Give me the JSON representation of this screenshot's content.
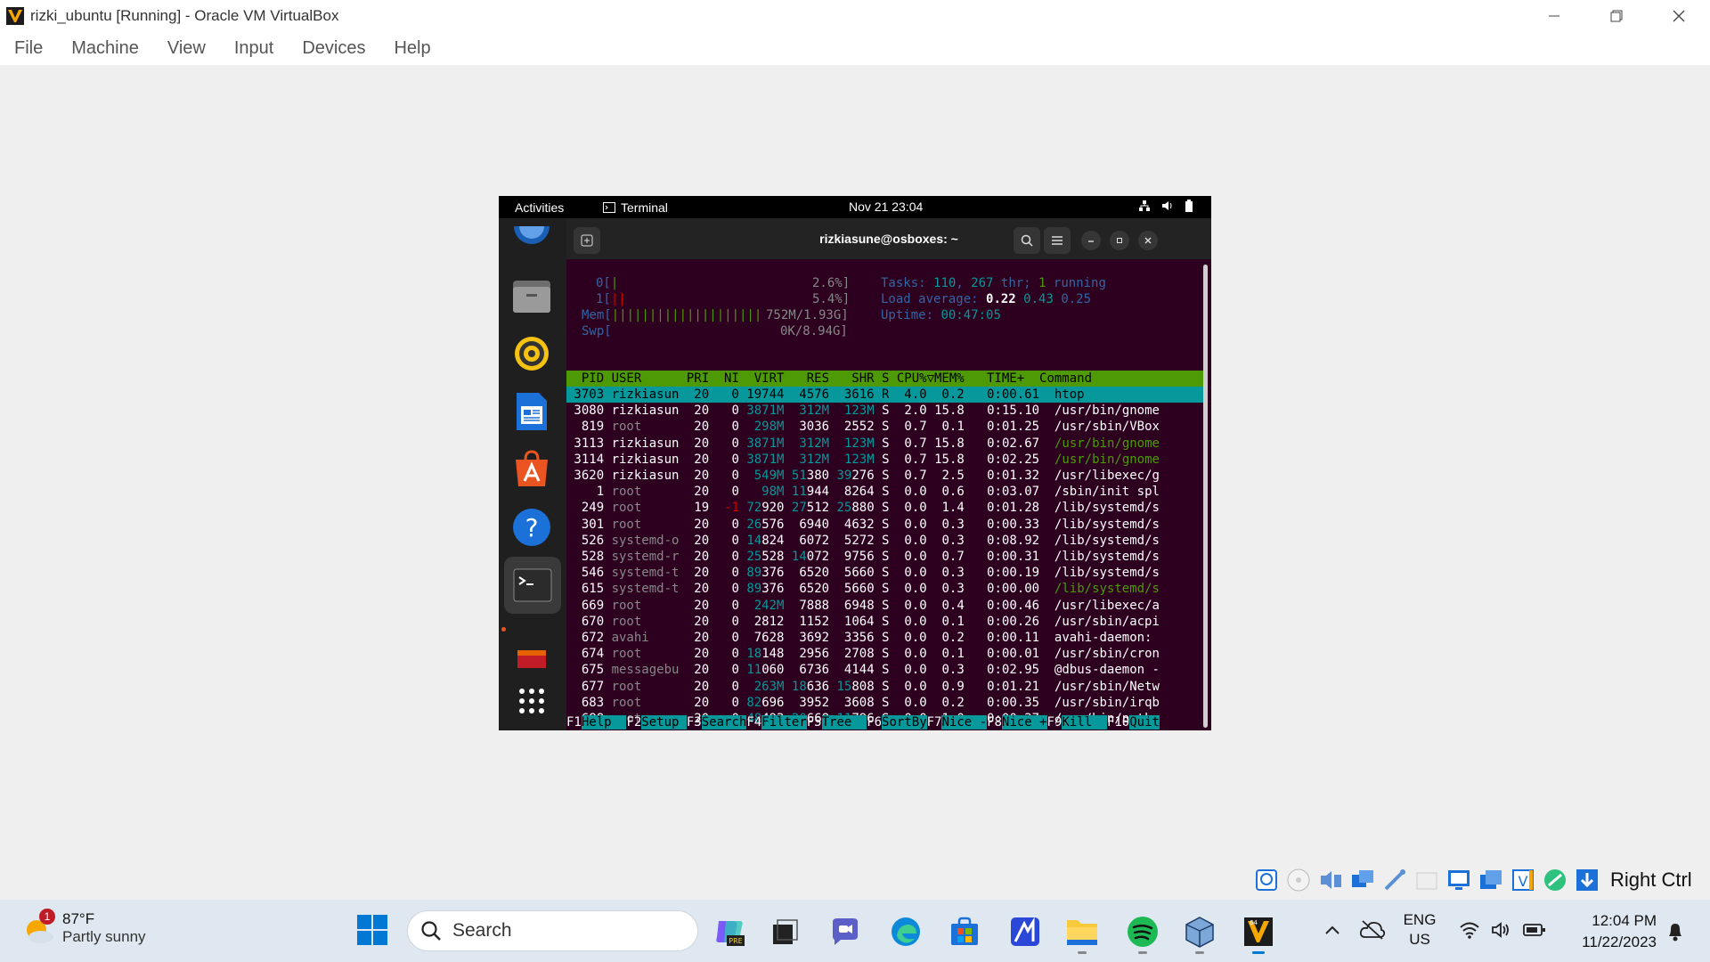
{
  "window": {
    "title": "rizki_ubuntu [Running] - Oracle VM VirtualBox"
  },
  "menu": [
    "File",
    "Machine",
    "View",
    "Input",
    "Devices",
    "Help"
  ],
  "guest": {
    "topbar": {
      "activities": "Activities",
      "app": "Terminal",
      "clock": "Nov 21  23:04"
    },
    "terminal": {
      "title": "rizkiasune@osboxes: ~"
    },
    "htop": {
      "meters": {
        "cpu0_label": "0[",
        "cpu0_bar": "|",
        "cpu0_val": "2.6%]",
        "cpu1_label": "1[",
        "cpu1_bar": "||",
        "cpu1_val": "5.4%]",
        "mem_label": "Mem[",
        "mem_bar": "||||||||||||||||||||",
        "mem_val": "752M/1.93G]",
        "swp_label": "Swp[",
        "swp_val": "0K/8.94G]"
      },
      "summary": {
        "tasks_label": "Tasks: ",
        "tasks": "110",
        "thr_sep": ", ",
        "thr": "267",
        "thr_label": " thr; ",
        "running": "1",
        "running_label": " running",
        "load_label": "Load average: ",
        "load1": "0.22",
        "load5": "0.43",
        "load15": "0.25",
        "uptime_label": "Uptime: ",
        "uptime": "00:47:05"
      },
      "header": "  PID USER      PRI  NI  VIRT   RES   SHR S CPU%▽MEM%   TIME+  Command",
      "rows": [
        {
          "pid": "3703",
          "user": "rizkiasun",
          "pri": "20",
          "ni": "0",
          "virt": "19744",
          "res": "4576",
          "shr": "3616",
          "s": "R",
          "cpu": "4.0",
          "mem": "0.2",
          "time": "0:00.61",
          "cmd": "htop"
        },
        {
          "pid": "3080",
          "user": "rizkiasun",
          "pri": "20",
          "ni": "0",
          "virt": "3871M",
          "res": "312M",
          "shr": "123M",
          "s": "S",
          "cpu": "2.0",
          "mem": "15.8",
          "time": "0:15.10",
          "cmd": "/usr/bin/gnome"
        },
        {
          "pid": "819",
          "user": "root",
          "pri": "20",
          "ni": "0",
          "virt": "298M",
          "res": "3036",
          "shr": "2552",
          "s": "S",
          "cpu": "0.7",
          "mem": "0.1",
          "time": "0:01.25",
          "cmd": "/usr/sbin/VBox"
        },
        {
          "pid": "3113",
          "user": "rizkiasun",
          "pri": "20",
          "ni": "0",
          "virt": "3871M",
          "res": "312M",
          "shr": "123M",
          "s": "S",
          "cpu": "0.7",
          "mem": "15.8",
          "time": "0:02.67",
          "cmd": "/usr/bin/gnome"
        },
        {
          "pid": "3114",
          "user": "rizkiasun",
          "pri": "20",
          "ni": "0",
          "virt": "3871M",
          "res": "312M",
          "shr": "123M",
          "s": "S",
          "cpu": "0.7",
          "mem": "15.8",
          "time": "0:02.25",
          "cmd": "/usr/bin/gnome"
        },
        {
          "pid": "3620",
          "user": "rizkiasun",
          "pri": "20",
          "ni": "0",
          "virt": "549M",
          "res": "51380",
          "shr": "39276",
          "s": "S",
          "cpu": "0.7",
          "mem": "2.5",
          "time": "0:01.32",
          "cmd": "/usr/libexec/g"
        },
        {
          "pid": "1",
          "user": "root",
          "pri": "20",
          "ni": "0",
          "virt": "98M",
          "res": "11944",
          "shr": "8264",
          "s": "S",
          "cpu": "0.0",
          "mem": "0.6",
          "time": "0:03.07",
          "cmd": "/sbin/init spl"
        },
        {
          "pid": "249",
          "user": "root",
          "pri": "19",
          "ni": "-1",
          "virt": "72920",
          "res": "27512",
          "shr": "25880",
          "s": "S",
          "cpu": "0.0",
          "mem": "1.4",
          "time": "0:01.28",
          "cmd": "/lib/systemd/s"
        },
        {
          "pid": "301",
          "user": "root",
          "pri": "20",
          "ni": "0",
          "virt": "26576",
          "res": "6940",
          "shr": "4632",
          "s": "S",
          "cpu": "0.0",
          "mem": "0.3",
          "time": "0:00.33",
          "cmd": "/lib/systemd/s"
        },
        {
          "pid": "526",
          "user": "systemd-o",
          "pri": "20",
          "ni": "0",
          "virt": "14824",
          "res": "6072",
          "shr": "5272",
          "s": "S",
          "cpu": "0.0",
          "mem": "0.3",
          "time": "0:08.92",
          "cmd": "/lib/systemd/s"
        },
        {
          "pid": "528",
          "user": "systemd-r",
          "pri": "20",
          "ni": "0",
          "virt": "25528",
          "res": "14072",
          "shr": "9756",
          "s": "S",
          "cpu": "0.0",
          "mem": "0.7",
          "time": "0:00.31",
          "cmd": "/lib/systemd/s"
        },
        {
          "pid": "546",
          "user": "systemd-t",
          "pri": "20",
          "ni": "0",
          "virt": "89376",
          "res": "6520",
          "shr": "5660",
          "s": "S",
          "cpu": "0.0",
          "mem": "0.3",
          "time": "0:00.19",
          "cmd": "/lib/systemd/s"
        },
        {
          "pid": "615",
          "user": "systemd-t",
          "pri": "20",
          "ni": "0",
          "virt": "89376",
          "res": "6520",
          "shr": "5660",
          "s": "S",
          "cpu": "0.0",
          "mem": "0.3",
          "time": "0:00.00",
          "cmd": "/lib/systemd/s"
        },
        {
          "pid": "669",
          "user": "root",
          "pri": "20",
          "ni": "0",
          "virt": "242M",
          "res": "7888",
          "shr": "6948",
          "s": "S",
          "cpu": "0.0",
          "mem": "0.4",
          "time": "0:00.46",
          "cmd": "/usr/libexec/a"
        },
        {
          "pid": "670",
          "user": "root",
          "pri": "20",
          "ni": "0",
          "virt": "2812",
          "res": "1152",
          "shr": "1064",
          "s": "S",
          "cpu": "0.0",
          "mem": "0.1",
          "time": "0:00.26",
          "cmd": "/usr/sbin/acpi"
        },
        {
          "pid": "672",
          "user": "avahi",
          "pri": "20",
          "ni": "0",
          "virt": "7628",
          "res": "3692",
          "shr": "3356",
          "s": "S",
          "cpu": "0.0",
          "mem": "0.2",
          "time": "0:00.11",
          "cmd": "avahi-daemon:"
        },
        {
          "pid": "674",
          "user": "root",
          "pri": "20",
          "ni": "0",
          "virt": "18148",
          "res": "2956",
          "shr": "2708",
          "s": "S",
          "cpu": "0.0",
          "mem": "0.1",
          "time": "0:00.01",
          "cmd": "/usr/sbin/cron"
        },
        {
          "pid": "675",
          "user": "messagebu",
          "pri": "20",
          "ni": "0",
          "virt": "11060",
          "res": "6736",
          "shr": "4144",
          "s": "S",
          "cpu": "0.0",
          "mem": "0.3",
          "time": "0:02.95",
          "cmd": "@dbus-daemon -"
        },
        {
          "pid": "677",
          "user": "root",
          "pri": "20",
          "ni": "0",
          "virt": "263M",
          "res": "18636",
          "shr": "15808",
          "s": "S",
          "cpu": "0.0",
          "mem": "0.9",
          "time": "0:01.21",
          "cmd": "/usr/sbin/Netw"
        },
        {
          "pid": "683",
          "user": "root",
          "pri": "20",
          "ni": "0",
          "virt": "82696",
          "res": "3952",
          "shr": "3608",
          "s": "S",
          "cpu": "0.0",
          "mem": "0.2",
          "time": "0:00.35",
          "cmd": "/usr/sbin/irqb"
        },
        {
          "pid": "688",
          "user": "root",
          "pri": "20",
          "ni": "0",
          "virt": "48492",
          "res": "20668",
          "shr": "11796",
          "s": "S",
          "cpu": "0.0",
          "mem": "1.0",
          "time": "0:00.27",
          "cmd": "/usr/bin/pytho"
        }
      ],
      "fkeys": [
        {
          "key": "F1",
          "label": "Help  "
        },
        {
          "key": "F2",
          "label": "Setup "
        },
        {
          "key": "F3",
          "label": "Search"
        },
        {
          "key": "F4",
          "label": "Filter"
        },
        {
          "key": "F5",
          "label": "Tree  "
        },
        {
          "key": "F6",
          "label": "SortBy"
        },
        {
          "key": "F7",
          "label": "Nice -"
        },
        {
          "key": "F8",
          "label": "Nice +"
        },
        {
          "key": "F9",
          "label": "Kill  "
        },
        {
          "key": "F10",
          "label": "Quit"
        }
      ]
    }
  },
  "vm_status": {
    "host_key": "Right Ctrl"
  },
  "taskbar": {
    "weather": {
      "temp": "87°F",
      "desc": "Partly sunny",
      "badge": "1"
    },
    "search_placeholder": "Search",
    "lang": {
      "line1": "ENG",
      "line2": "US"
    },
    "time": "12:04 PM",
    "date": "11/22/2023"
  },
  "colors": {
    "accent": "#06989a",
    "htop_header": "#4e9a06",
    "terminal_bg": "#2c001e"
  }
}
